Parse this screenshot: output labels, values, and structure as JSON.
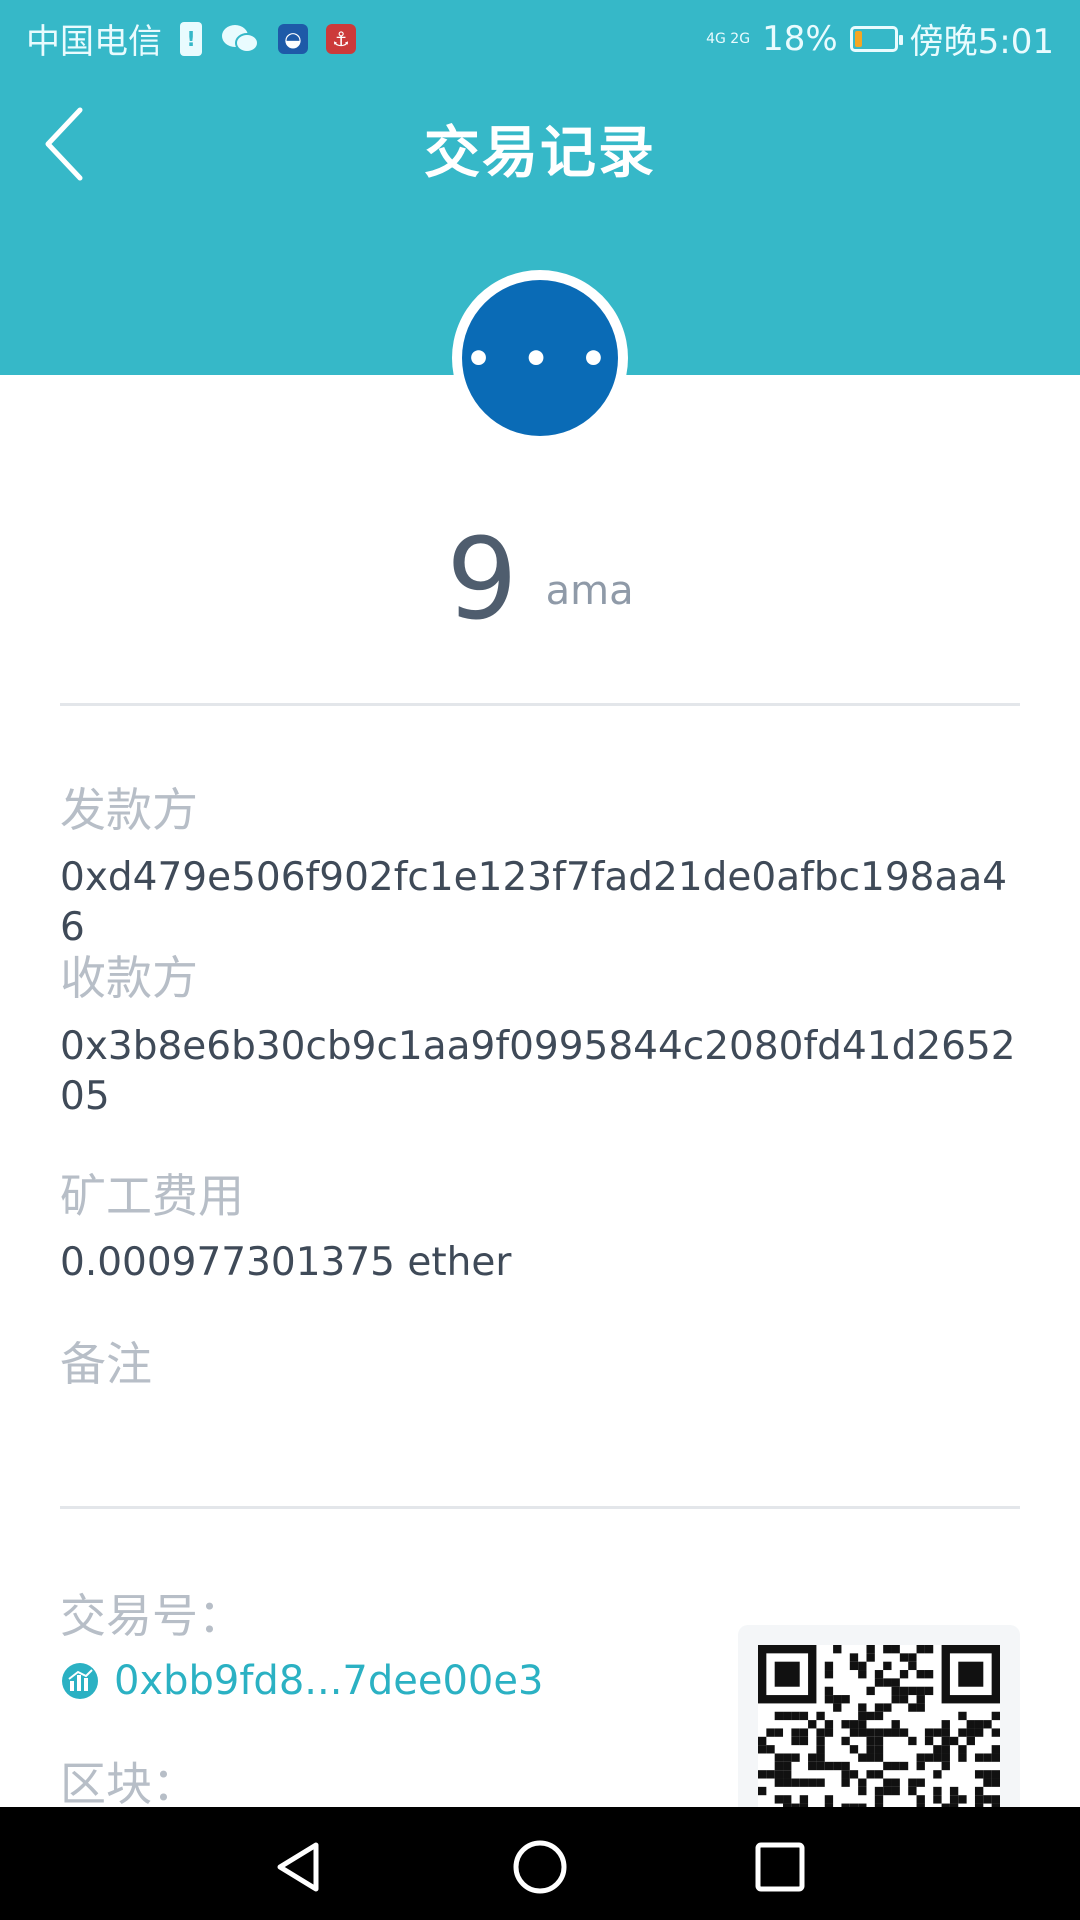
{
  "status_bar": {
    "carrier": "中国电信",
    "network": "4G 2G",
    "battery_percent": "18%",
    "battery_level": 0.18,
    "time": "傍晚5:01",
    "battery_fill_color": "#f5a623"
  },
  "header": {
    "title": "交易记录",
    "back_icon": "chevron-left-icon",
    "bg_color": "#36b8c8"
  },
  "status": {
    "icon": "more-dots-icon",
    "glyph": "• • •",
    "color": "#0a6bb6"
  },
  "amount": {
    "value": "9",
    "unit": "ama"
  },
  "details": {
    "sender_label": "发款方",
    "sender_value": "0xd479e506f902fc1e123f7fad21de0afbc198aa46",
    "receiver_label": "收款方",
    "receiver_value": "0x3b8e6b30cb9c1aa9f0995844c2080fd41d265205",
    "fee_label": "矿工费用",
    "fee_value": "0.000977301375 ether",
    "note_label": "备注",
    "note_value": ""
  },
  "transaction": {
    "tx_label": "交易号：",
    "tx_hash": "0xbb9fd8...7dee00e3",
    "block_label": "区块："
  },
  "nav": {
    "back_icon": "triangle-back-icon",
    "home_icon": "circle-home-icon",
    "recents_icon": "square-recents-icon"
  }
}
